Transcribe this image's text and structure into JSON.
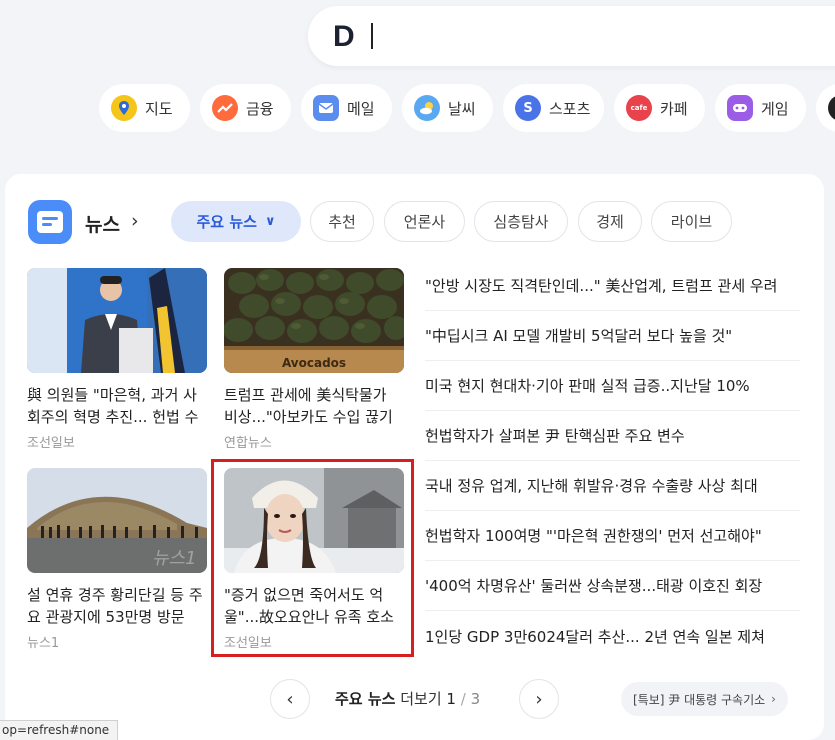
{
  "search": {
    "logo": "D"
  },
  "services": [
    {
      "label": "지도",
      "icon": "map-pin-icon",
      "color": "#f5c518"
    },
    {
      "label": "금융",
      "icon": "chart-up-icon",
      "color": "#ff6b3d"
    },
    {
      "label": "메일",
      "icon": "mail-icon",
      "color": "#5b8def"
    },
    {
      "label": "날씨",
      "icon": "weather-icon",
      "color": "#5aa8f0"
    },
    {
      "label": "스포츠",
      "icon": "sports-icon",
      "color": "#4a73e8"
    },
    {
      "label": "카페",
      "icon": "cafe-icon",
      "color": "#e8424c"
    },
    {
      "label": "게임",
      "icon": "game-icon",
      "color": "#9b5de5"
    }
  ],
  "news": {
    "title": "뉴스",
    "tabs": [
      "주요 뉴스",
      "추천",
      "언론사",
      "심층탐사",
      "경제",
      "라이브"
    ],
    "active_tab": "주요 뉴스",
    "thumbs": [
      {
        "title": "與 의원들 \"마은혁, 과거 사회주의 혁명 추진... 헌법 수호 의지 없어\"",
        "source": "조선일보"
      },
      {
        "title": "트럼프 관세에 美식탁물가 비상...\"아보카도 수입 끊기면\"",
        "source": "연합뉴스",
        "image_text": "Avocados"
      },
      {
        "title": "설 연휴 경주 황리단길 등 주요 관광지에 53만명 방문",
        "source": "뉴스1",
        "watermark": "뉴스1"
      },
      {
        "title": "\"증거 없으면 죽어서도 억울\"...故오요안나 유족 호소",
        "source": "조선일보"
      }
    ],
    "headlines": [
      "\"안방 시장도 직격탄인데...\" 美산업계, 트럼프 관세 우려",
      "\"中딥시크 AI 모델 개발비 5억달러 보다 높을 것\"",
      "미국 현지 현대차·기아 판매 실적 급증..지난달 10%",
      "헌법학자가 살펴본 尹 탄핵심판 주요 변수",
      "국내 정유 업계, 지난해 휘발유·경유 수출량 사상 최대",
      "헌법학자 100여명 \"'마은혁 권한쟁의' 먼저 선고해야\"",
      "'400억 차명유산' 둘러싼 상속분쟁...태광 이호진 회장",
      "1인당 GDP 3만6024달러 추산... 2년 연속 일본 제쳐"
    ],
    "pager": {
      "label": "주요 뉴스",
      "more": "더보기",
      "current": "1",
      "separator": "/",
      "total": "3"
    },
    "special_link": "[특보] 尹 대통령 구속기소"
  },
  "status_url": "op=refresh#none"
}
